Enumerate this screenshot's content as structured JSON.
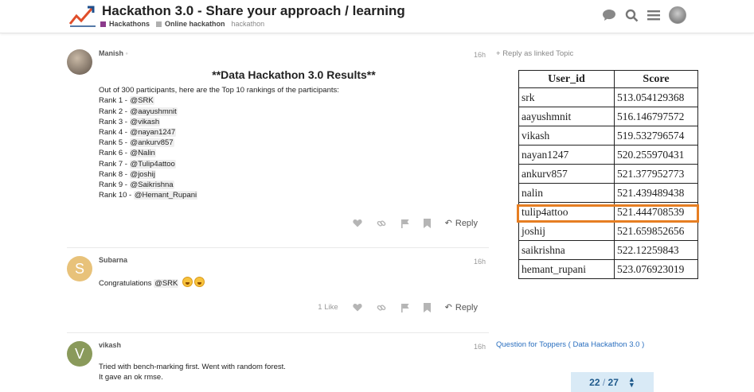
{
  "header": {
    "title": "Hackathon 3.0 - Share your approach / learning",
    "categories": [
      {
        "label": "Hackathons",
        "color": "#8b3a8b"
      },
      {
        "label": "Online hackathon",
        "color": "#b0b0b0"
      }
    ],
    "tag": "hackathon",
    "icons": [
      "chat-icon",
      "search-icon",
      "menu-icon",
      "user-avatar"
    ]
  },
  "posts": [
    {
      "username": "Manish",
      "time": "16h",
      "results_title": "**Data Hackathon 3.0 Results**",
      "intro": "Out of 300 participants, here are the Top 10 rankings of the participants:",
      "ranks": [
        {
          "label": "Rank 1 - ",
          "user": "@SRK"
        },
        {
          "label": "Rank 2 - ",
          "user": "@aayushmnit"
        },
        {
          "label": "Rank 3 - ",
          "user": "@vikash"
        },
        {
          "label": "Rank 4 - ",
          "user": "@nayan1247"
        },
        {
          "label": "Rank 5 - ",
          "user": "@ankurv857"
        },
        {
          "label": "Rank 6 - ",
          "user": "@Nalin"
        },
        {
          "label": "Rank 7 - ",
          "user": "@Tulip4attoo"
        },
        {
          "label": "Rank 8 - ",
          "user": "@joshij"
        },
        {
          "label": "Rank 9 - ",
          "user": "@Saikrishna"
        },
        {
          "label": "Rank 10 - ",
          "user": "@Hemant_Rupani"
        }
      ],
      "reply_label": "Reply"
    },
    {
      "username": "Subarna",
      "avatar_letter": "S",
      "avatar_color": "#e8c27a",
      "time": "16h",
      "text": "Congratulations",
      "mention": "@SRK",
      "likes": "1 Like",
      "reply_label": "Reply"
    },
    {
      "username": "vikash",
      "avatar_letter": "V",
      "avatar_color": "#8a9a5b",
      "time": "16h",
      "line1": "Tried with bench-marking first. Went with random forest.",
      "line2": "It gave an ok rmse."
    }
  ],
  "sidebar": {
    "reply_linked": "Reply as linked Topic",
    "related_topic": "Question for Toppers ( Data Hackathon 3.0 )",
    "pager": {
      "current": "22",
      "separator": "/",
      "total": "27"
    }
  },
  "score_table": {
    "headers": [
      "User_id",
      "Score"
    ],
    "rows": [
      [
        "srk",
        "513.054129368"
      ],
      [
        "aayushmnit",
        "516.146797572"
      ],
      [
        "vikash",
        "519.532796574"
      ],
      [
        "nayan1247",
        "520.255970431"
      ],
      [
        "ankurv857",
        "521.377952773"
      ],
      [
        "nalin",
        "521.439489438"
      ],
      [
        "tulip4attoo",
        "521.444708539"
      ],
      [
        "joshij",
        "521.659852656"
      ],
      [
        "saikrishna",
        "522.12259843"
      ],
      [
        "hemant_rupani",
        "523.076923019"
      ]
    ],
    "highlight_row": 6,
    "highlight_color": "#e67e22"
  }
}
